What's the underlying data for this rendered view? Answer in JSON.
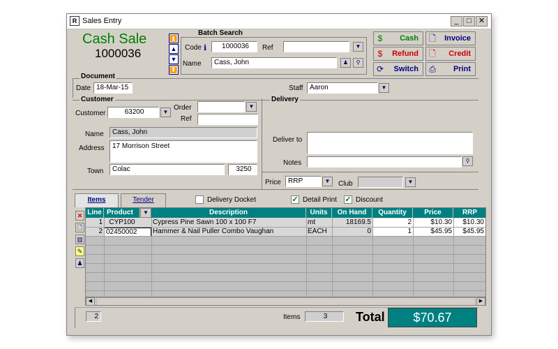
{
  "window": {
    "title": "Sales Entry",
    "min": "_",
    "max": "□",
    "close": "✕"
  },
  "header": {
    "mode": "Cash Sale",
    "number": "1000036"
  },
  "batch": {
    "title": "Batch Search",
    "code_label": "Code",
    "code": "1000036",
    "ref_label": "Ref",
    "ref": "",
    "name_label": "Name",
    "name": "Cass, John"
  },
  "actions": {
    "cash": "Cash",
    "refund": "Refund",
    "switch": "Switch",
    "invoice": "Invoice",
    "credit": "Credit",
    "print": "Print"
  },
  "document": {
    "title": "Document",
    "date_label": "Date",
    "date": "18-Mar-15",
    "staff_label": "Staff",
    "staff": "Aaron"
  },
  "customer": {
    "title": "Customer",
    "customer_label": "Customer",
    "customer": "63200",
    "order_label": "Order",
    "order": "",
    "ref_label": "Ref",
    "ref": "",
    "name_label": "Name",
    "name": "Cass, John",
    "address_label": "Address",
    "address": "17 Morrison Street",
    "town_label": "Town",
    "town": "Colac",
    "postcode": "3250"
  },
  "delivery": {
    "title": "Delivery",
    "deliver_to_label": "Deliver to",
    "notes_label": "Notes",
    "price_label": "Price",
    "price": "RRP",
    "club_label": "Club",
    "club": ""
  },
  "tabs": {
    "items": "Items",
    "tender": "Tender"
  },
  "options": {
    "delivery_docket": "Delivery Docket",
    "detail_print": "Detail Print",
    "discount": "Discount",
    "delivery_docket_checked": false,
    "detail_print_checked": true,
    "discount_checked": true
  },
  "grid": {
    "columns": [
      "Line",
      "Product",
      "Description",
      "Units",
      "On Hand",
      "Quantity",
      "Price",
      "RRP"
    ],
    "rows": [
      {
        "line": "1",
        "product": "CYP100",
        "description": "Cypress Pine Sawn 100 x 100 F7",
        "units": "mt",
        "on_hand": "18169.5",
        "quantity": "2",
        "price": "$10.30",
        "rrp": "$10.30"
      },
      {
        "line": "2",
        "product": "02450002",
        "description": "Hammer & Nail Puller Combo Vaughan",
        "units": "EACH",
        "on_hand": "0",
        "quantity": "1",
        "price": "$45.95",
        "rrp": "$45.95"
      }
    ]
  },
  "footer": {
    "line_count": "2",
    "items_label": "Items",
    "items": "3",
    "total_label": "Total",
    "total": "$70.67"
  },
  "colors": {
    "grid_header": "#008080",
    "total_bg": "#008080",
    "mode_text": "#008000"
  }
}
